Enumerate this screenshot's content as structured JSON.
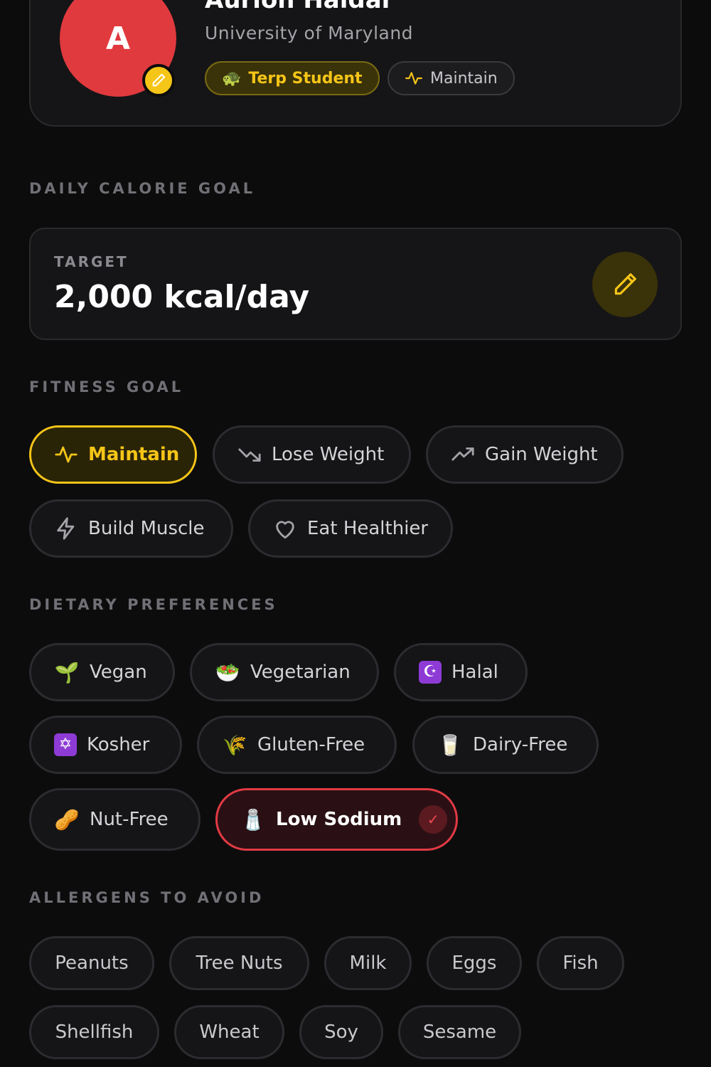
{
  "profile": {
    "avatar_initial": "A",
    "name": "Aurion Haldar",
    "school": "University of Maryland",
    "badges": {
      "terp": "Terp Student",
      "terp_emoji": "🐢",
      "goal": "Maintain"
    }
  },
  "calorie": {
    "section_title": "DAILY CALORIE GOAL",
    "label": "TARGET",
    "value": "2,000 kcal/day"
  },
  "fitness": {
    "section_title": "FITNESS GOAL",
    "options": [
      "Maintain",
      "Lose Weight",
      "Gain Weight",
      "Build Muscle",
      "Eat Healthier"
    ],
    "selected": "Maintain"
  },
  "dietary": {
    "section_title": "DIETARY PREFERENCES",
    "options": [
      {
        "label": "Vegan",
        "emoji": "🌱"
      },
      {
        "label": "Vegetarian",
        "emoji": "🥗"
      },
      {
        "label": "Halal",
        "emoji": "☪"
      },
      {
        "label": "Kosher",
        "emoji": "✡"
      },
      {
        "label": "Gluten-Free",
        "emoji": "🌾"
      },
      {
        "label": "Dairy-Free",
        "emoji": "🥛"
      },
      {
        "label": "Nut-Free",
        "emoji": "🥜"
      },
      {
        "label": "Low Sodium",
        "emoji": "🧂"
      }
    ],
    "selected": "Low Sodium"
  },
  "allergens": {
    "section_title": "ALLERGENS TO AVOID",
    "options": [
      "Peanuts",
      "Tree Nuts",
      "Milk",
      "Eggs",
      "Fish",
      "Shellfish",
      "Wheat",
      "Soy",
      "Sesame"
    ]
  },
  "colors": {
    "accent_yellow": "#f5c518",
    "accent_red": "#e23a44",
    "avatar_bg": "#e03a3e"
  }
}
